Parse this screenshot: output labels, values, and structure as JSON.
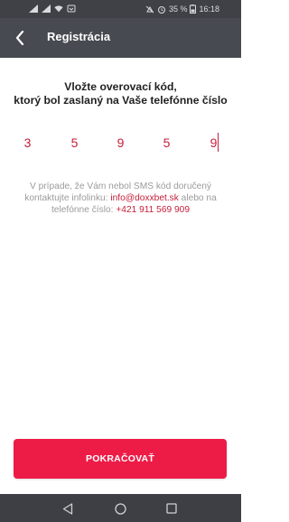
{
  "status_bar": {
    "battery": "35 %",
    "time": "16:18",
    "icons": [
      "signal-icon",
      "signal-icon",
      "wifi-icon",
      "notification-icon",
      "mute-icon",
      "alarm-icon",
      "battery-icon"
    ]
  },
  "app_bar": {
    "title": "Registrácia",
    "back_icon": "chevron-left-icon"
  },
  "instruction": {
    "line1": "Vložte overovací kód,",
    "line2": "ktorý bol zaslaný na Vaše telefónne číslo"
  },
  "code_digits": [
    "3",
    "5",
    "9",
    "5",
    "9"
  ],
  "info": {
    "line1": "V prípade, že Vám nebol SMS kód doručený",
    "line2_prefix": "kontaktujte infolinku: ",
    "email": "info@doxxbet.sk",
    "line2_suffix": " alebo na",
    "line3_prefix": "telefónne číslo: ",
    "phone": "+421 911 569 909"
  },
  "continue_button": {
    "label": "POKRAČOVAŤ"
  },
  "nav_bar": {
    "icons": [
      "back-triangle-icon",
      "home-circle-icon",
      "recents-square-icon"
    ]
  },
  "colors": {
    "accent": "#ed1c47",
    "text_red": "#c41e3a",
    "app_bar": "#474a50",
    "status_bar": "#3f4147",
    "nav_bar": "#3d3f44"
  }
}
